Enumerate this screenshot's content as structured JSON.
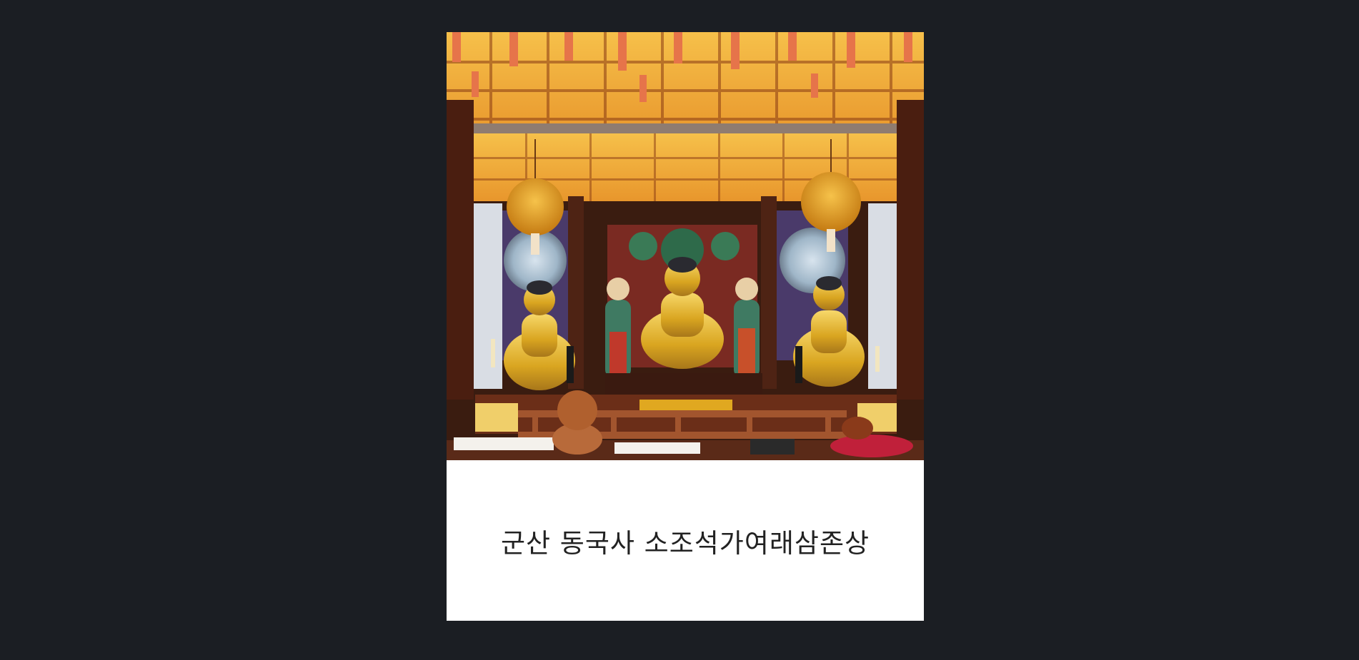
{
  "photo": {
    "caption": "군산 동국사 소조석가여래삼존상"
  },
  "colors": {
    "page_background": "#1b1e23",
    "card_background": "#ffffff",
    "caption_text": "#222222",
    "ceiling_gold": "#f5b83a",
    "lantern_orange": "#e9873a",
    "gilt": "#d9a520",
    "wood": "#5a2a18"
  }
}
